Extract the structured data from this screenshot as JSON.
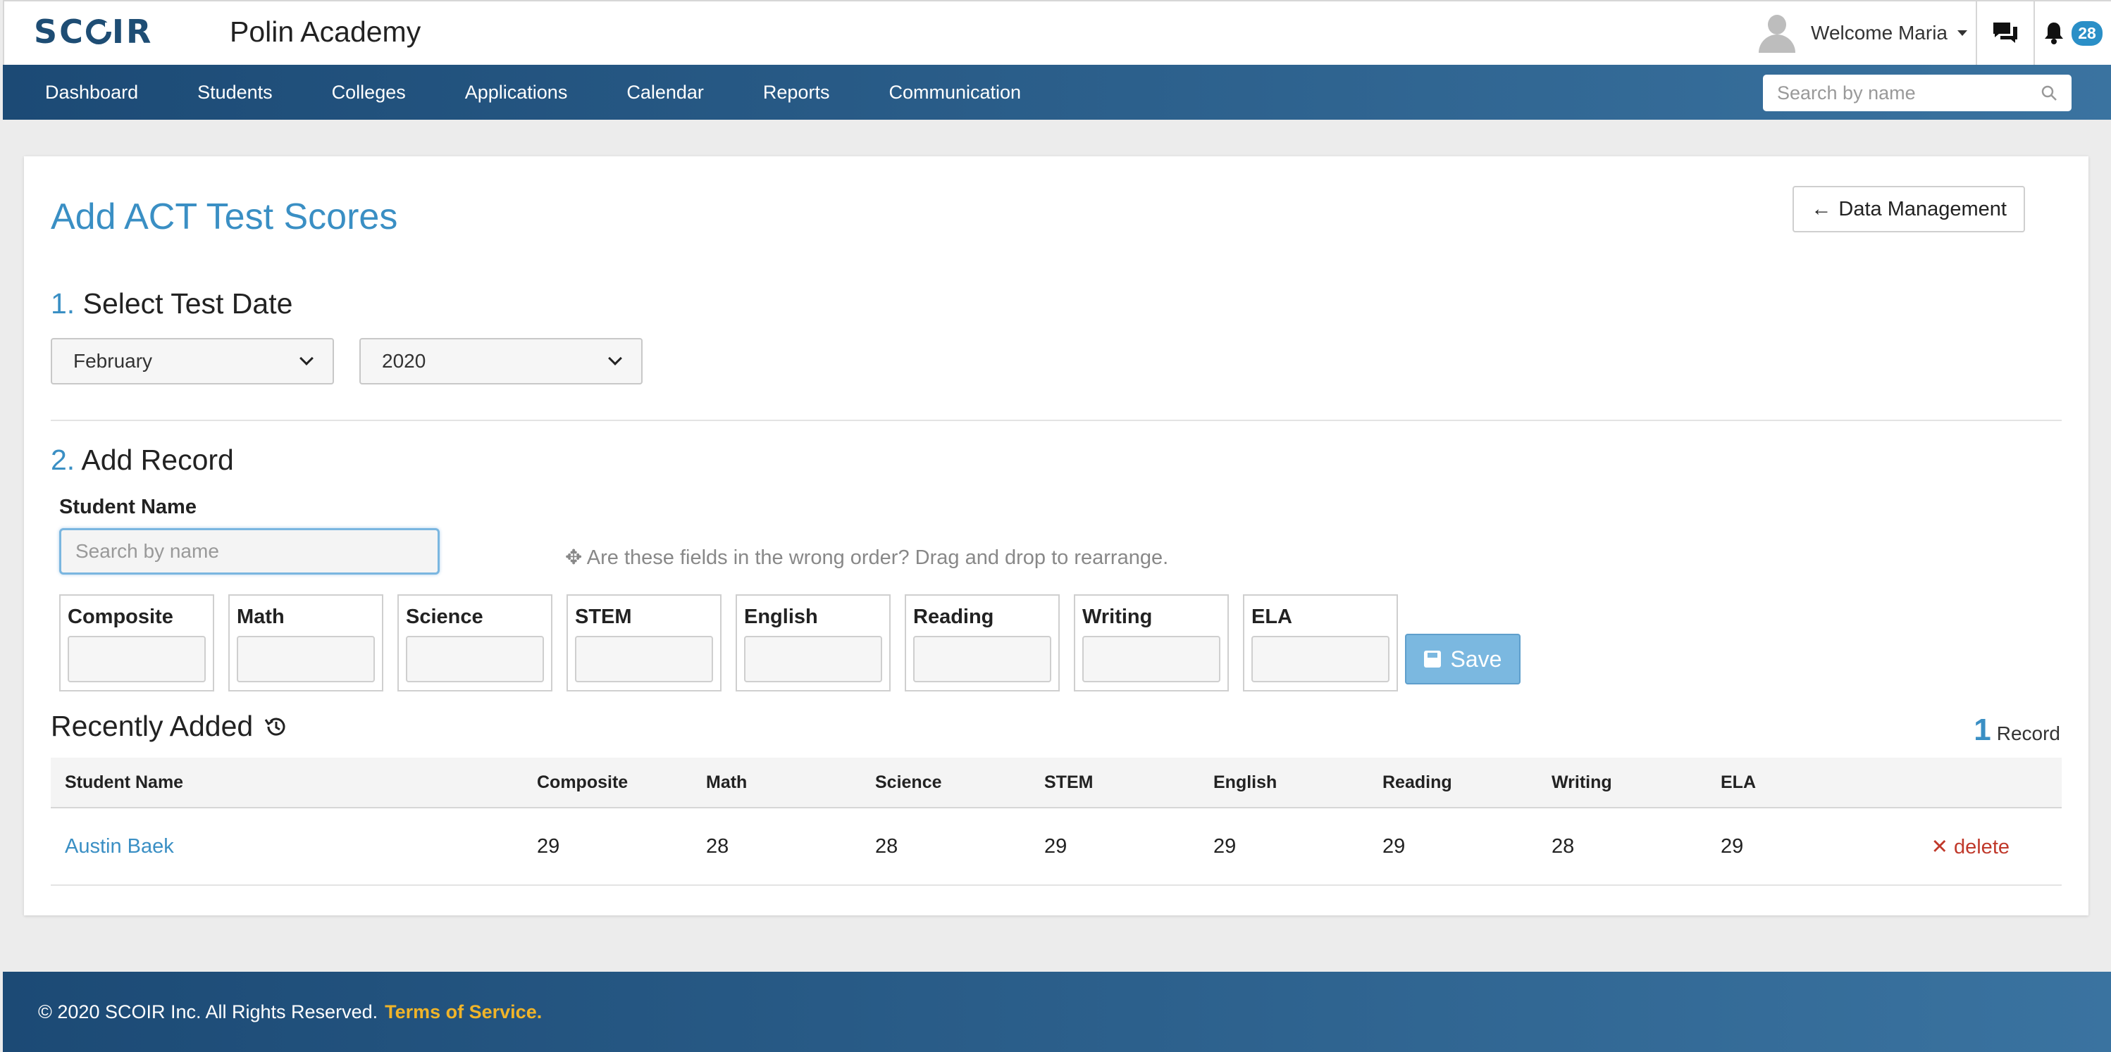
{
  "header": {
    "logo": "SCOIR",
    "school": "Polin Academy",
    "welcome": "Welcome Maria",
    "notification_count": "28"
  },
  "nav": {
    "items": [
      "Dashboard",
      "Students",
      "Colleges",
      "Applications",
      "Calendar",
      "Reports",
      "Communication"
    ],
    "search_placeholder": "Search by name"
  },
  "page": {
    "title": "Add ACT Test Scores",
    "back_button": "Data Management",
    "step1": {
      "num": "1.",
      "label": "Select Test Date",
      "month": "February",
      "year": "2020"
    },
    "step2": {
      "num": "2.",
      "label": "Add Record",
      "student_label": "Student Name",
      "student_placeholder": "Search by name",
      "hint": "Are these fields in the wrong order? Drag and drop to rearrange."
    },
    "fields": [
      "Composite",
      "Math",
      "Science",
      "STEM",
      "English",
      "Reading",
      "Writing",
      "ELA"
    ],
    "save_label": "Save"
  },
  "recent": {
    "title": "Recently Added",
    "count": "1",
    "count_label": "Record",
    "columns": [
      "Student Name",
      "Composite",
      "Math",
      "Science",
      "STEM",
      "English",
      "Reading",
      "Writing",
      "ELA"
    ],
    "rows": [
      {
        "name": "Austin Baek",
        "values": [
          "29",
          "28",
          "28",
          "29",
          "29",
          "29",
          "28",
          "29"
        ],
        "delete": "delete"
      }
    ]
  },
  "footer": {
    "copyright": "© 2020 SCOIR Inc. All Rights Reserved.",
    "tos": "Terms of Service."
  },
  "colors": {
    "accent": "#3a8fc4",
    "nav": "#1c4a75",
    "danger": "#c0392b",
    "link_yellow": "#f0b429"
  }
}
